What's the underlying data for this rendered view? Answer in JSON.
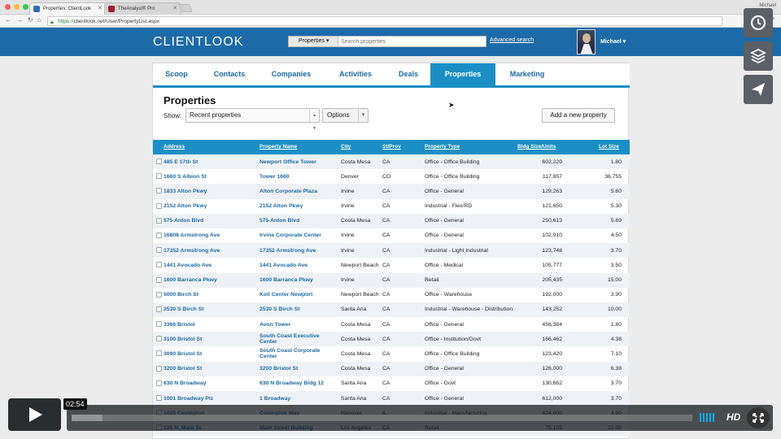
{
  "browser": {
    "tabs": [
      {
        "title": "Properties: ClientLook",
        "active": true,
        "favicon_color": "#2d6db4"
      },
      {
        "title": "TheAnalyst® Pro",
        "active": false,
        "favicon_color": "#a01c2c"
      }
    ],
    "profile": "Michael",
    "url_scheme": "https://",
    "url_rest": "clientlook.net/User/PropertyList.aspx"
  },
  "header": {
    "logo": "CLIENTLOOK",
    "search_scope": "Properties",
    "search_placeholder": "Search properties",
    "advanced_search": "Advanced search",
    "user": "Michael ▾"
  },
  "nav": {
    "tabs": [
      "Scoop",
      "Contacts",
      "Companies",
      "Activities",
      "Deals",
      "Properties",
      "Marketing"
    ],
    "active": "Properties"
  },
  "page": {
    "title": "Properties",
    "show_label": "Show:",
    "show_value": "Recent properties",
    "options_label": "Options",
    "add_label": "Add a new property"
  },
  "table": {
    "headers": [
      "Address",
      "Property Name",
      "City",
      "St/Prov",
      "Property Type",
      "Bldg Size/Units",
      "Lot Size"
    ],
    "rows": [
      [
        "485 E 17th St",
        "Newport Office Tower",
        "Costa Mesa",
        "CA",
        "Office - Office Building",
        "602,220",
        "1.80"
      ],
      [
        "1660 S Albion St",
        "Tower 1660",
        "Denver",
        "CO",
        "Office - Office Building",
        "117,857",
        "36,755"
      ],
      [
        "1833 Alton Pkwy",
        "Alton Corporate Plaza",
        "Irvine",
        "CA",
        "Office - General",
        "129,263",
        "5.60"
      ],
      [
        "2152 Alton Pkwy",
        "2152 Alton Pkwy",
        "Irvine",
        "CA",
        "Industrial - Flex/RD",
        "121,650",
        "5.30"
      ],
      [
        "575 Anton Blvd",
        "575 Anton Blvd",
        "Costa Mesa",
        "CA",
        "Office - General",
        "250,613",
        "5.69"
      ],
      [
        "16808 Armstrong Ave",
        "Irvine Corporate Center",
        "Irvine",
        "CA",
        "Office - General",
        "102,910",
        "4.50"
      ],
      [
        "17352 Armstrong Ave",
        "17352 Armstrong Ave",
        "Irvine",
        "CA",
        "Industrial - Light Industrial",
        "123,748",
        "3.70"
      ],
      [
        "1441 Avocado Ave",
        "1441 Avocado Ave",
        "Newport Beach",
        "CA",
        "Office - Medical",
        "105,777",
        "3.50"
      ],
      [
        "1600 Barranca Pkwy",
        "1600 Barranca Pkwy",
        "Irvine",
        "CA",
        "Retail",
        "205,435",
        "15.00"
      ],
      [
        "5000 Birch St",
        "Koll Center Newport",
        "Newport Beach",
        "CA",
        "Office - Warehouse",
        "192,000",
        "3.90"
      ],
      [
        "2530 S Birch St",
        "2530 S Birch St",
        "Santa Ana",
        "CA",
        "Industrial - Warehouse - Distribution",
        "143,252",
        "10.00"
      ],
      [
        "3366 Bristol",
        "Avon Tower",
        "Costa Mesa",
        "CA",
        "Office - General",
        "456,384",
        "1.80"
      ],
      [
        "3100 Bristol St",
        "South Coast Executive Center",
        "Costa Mesa",
        "CA",
        "Office - Institution/Govt",
        "166,462",
        "4.38"
      ],
      [
        "3090 Bristol St",
        "South Coast Corporate Center",
        "Costa Mesa",
        "CA",
        "Office - Office Building",
        "123,420",
        "7.10"
      ],
      [
        "3200 Bristol St",
        "3200 Bristol St",
        "Costa Mesa",
        "CA",
        "Office - General",
        "126,000",
        "6.38"
      ],
      [
        "630 N Broadway",
        "630 N Broadway Bldg 12",
        "Santa Ana",
        "CA",
        "Office - Govt",
        "130,662",
        "3.70"
      ],
      [
        "1001 Broadway Plz",
        "1 Broadway",
        "Santa Ana",
        "CA",
        "Office - General",
        "612,000",
        "3.70"
      ],
      [
        "1025 Covington",
        "Covington Way",
        "Hanover",
        "IL",
        "Industrial - Manufacturing",
        "424,000",
        "3.90"
      ],
      [
        "125 N. Main St.",
        "Main Street Building",
        "Los Angeles",
        "CA",
        "Retail",
        "75,155",
        "15.00"
      ]
    ]
  },
  "player": {
    "time": "02:54",
    "hd": "HD",
    "accent": "#00adef",
    "buffered_fraction": 0.05
  },
  "sidebar_icons": [
    "clock-icon",
    "layers-icon",
    "send-icon"
  ]
}
